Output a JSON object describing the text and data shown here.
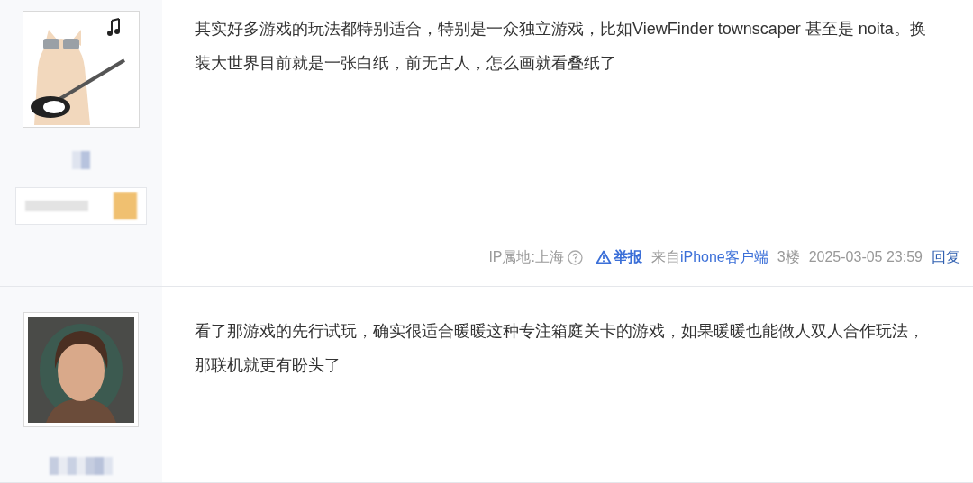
{
  "posts": [
    {
      "badge": true,
      "content": "其实好多游戏的玩法都特别适合，特别是一众独立游戏，比如ViewFinder townscaper 甚至是 noita。换装大世界目前就是一张白纸，前无古人，怎么画就看叠纸了",
      "footer": {
        "ip_location": "IP属地:上海",
        "report": "举报",
        "source_prefix": "来自",
        "source_link": "iPhone客户端",
        "floor": "3楼",
        "time": "2025-03-05 23:59",
        "reply": "回复"
      }
    },
    {
      "content": "看了那游戏的先行试玩，确实很适合暖暖这种专注箱庭关卡的游戏，如果暖暖也能做人双人合作玩法，那联机就更有盼头了"
    }
  ]
}
